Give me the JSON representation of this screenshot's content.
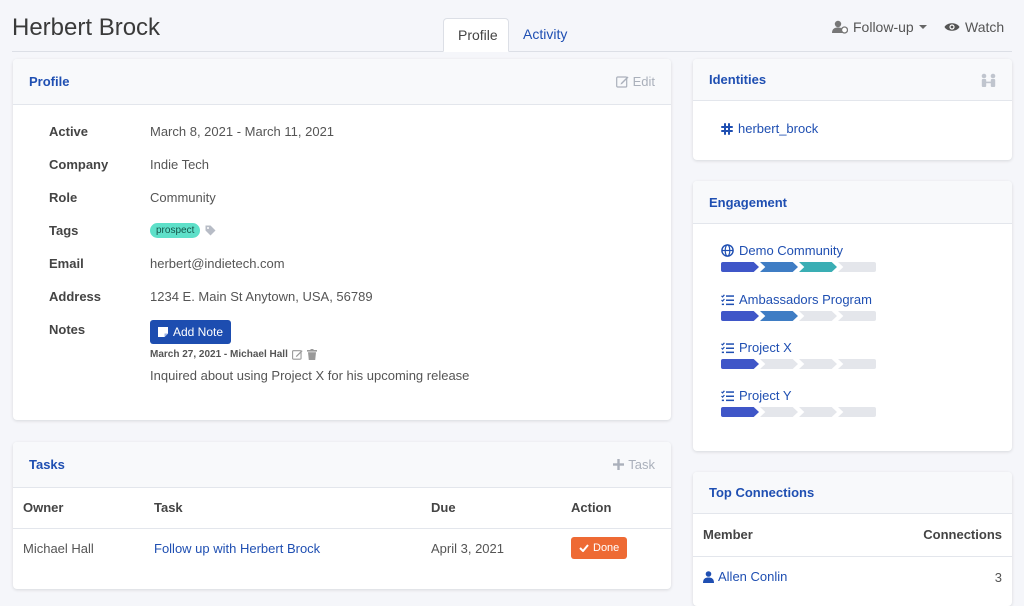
{
  "header": {
    "title": "Herbert Brock",
    "tabs": [
      {
        "label": "Profile"
      },
      {
        "label": "Activity"
      }
    ],
    "follow_up_label": "Follow-up",
    "watch_label": "Watch"
  },
  "profile": {
    "title": "Profile",
    "edit_label": "Edit",
    "fields": {
      "active": {
        "label": "Active",
        "value": "March 8, 2021 - March 11, 2021"
      },
      "company": {
        "label": "Company",
        "value": "Indie Tech"
      },
      "role": {
        "label": "Role",
        "value": "Community"
      },
      "tags": {
        "label": "Tags",
        "value": "prospect"
      },
      "email": {
        "label": "Email",
        "value": "herbert@indietech.com"
      },
      "address": {
        "label": "Address",
        "value": "1234 E. Main St Anytown, USA, 56789"
      },
      "notes": {
        "label": "Notes"
      }
    },
    "add_note_label": "Add Note",
    "note": {
      "meta": "March 27, 2021 - Michael Hall",
      "text": "Inquired about using Project X for his upcoming release"
    }
  },
  "tasks": {
    "title": "Tasks",
    "add_label": "Task",
    "columns": [
      "Owner",
      "Task",
      "Due",
      "Action"
    ],
    "rows": [
      {
        "owner": "Michael Hall",
        "task": "Follow up with Herbert Brock",
        "due": "April 3, 2021",
        "action": "Done"
      }
    ]
  },
  "identities": {
    "title": "Identities",
    "items": [
      {
        "icon": "slack-icon",
        "name": "herbert_brock"
      }
    ]
  },
  "engagement": {
    "title": "Engagement",
    "items": [
      {
        "icon": "globe-icon",
        "name": "Demo Community",
        "level": 3,
        "colors": [
          "#3f56c8",
          "#3f7dc4",
          "#3aaeb4"
        ]
      },
      {
        "icon": "list-icon",
        "name": "Ambassadors Program",
        "level": 2,
        "colors": [
          "#3f56c8",
          "#3f7dc4"
        ]
      },
      {
        "icon": "list-icon",
        "name": "Project X",
        "level": 1,
        "colors": [
          "#3f56c8"
        ]
      },
      {
        "icon": "list-icon",
        "name": "Project Y",
        "level": 1,
        "colors": [
          "#3f56c8"
        ]
      }
    ],
    "total_steps": 4
  },
  "connections": {
    "title": "Top Connections",
    "columns": [
      "Member",
      "Connections"
    ],
    "rows": [
      {
        "member": "Allen Conlin",
        "count": "3"
      }
    ]
  }
}
